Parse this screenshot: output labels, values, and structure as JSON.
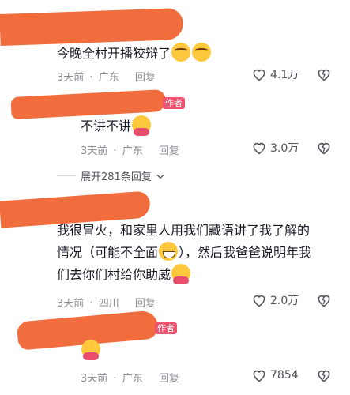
{
  "top_meta": {
    "text": "…"
  },
  "comments": [
    {
      "text": "今晚全村开播狡辩了",
      "emojis": [
        "crying-laughing-emoji",
        "crying-laughing-emoji"
      ],
      "time": "3天前",
      "location": "广东",
      "reply": "回复",
      "likes": "4.1万"
    },
    {
      "author_badge": "作者",
      "text": "不讲不讲",
      "emojis": [
        "hugging-emoji"
      ],
      "time": "3天前",
      "location": "广东",
      "reply": "回复",
      "likes": "3.0万",
      "expand": "展开281条回复"
    },
    {
      "line1": "我很冒火，和家里人用我们藏语讲了我了解的",
      "line2a": "情况（可能不全面",
      "line2b": "），然后我爸爸说明年我",
      "line3": "们去你们村给你助威",
      "emojis": [
        "grinning-emoji",
        "hugging-emoji"
      ],
      "time": "3天前",
      "location": "四川",
      "reply": "回复",
      "likes": "2.0万"
    },
    {
      "author_badge": "作者",
      "emojis": [
        "hugging-emoji"
      ],
      "time": "3天前",
      "location": "广东",
      "reply": "回复",
      "likes": "7854"
    }
  ],
  "colors": {
    "redaction": "#f26d3d",
    "meta": "#8a8b91",
    "badge": "#f0506e"
  }
}
